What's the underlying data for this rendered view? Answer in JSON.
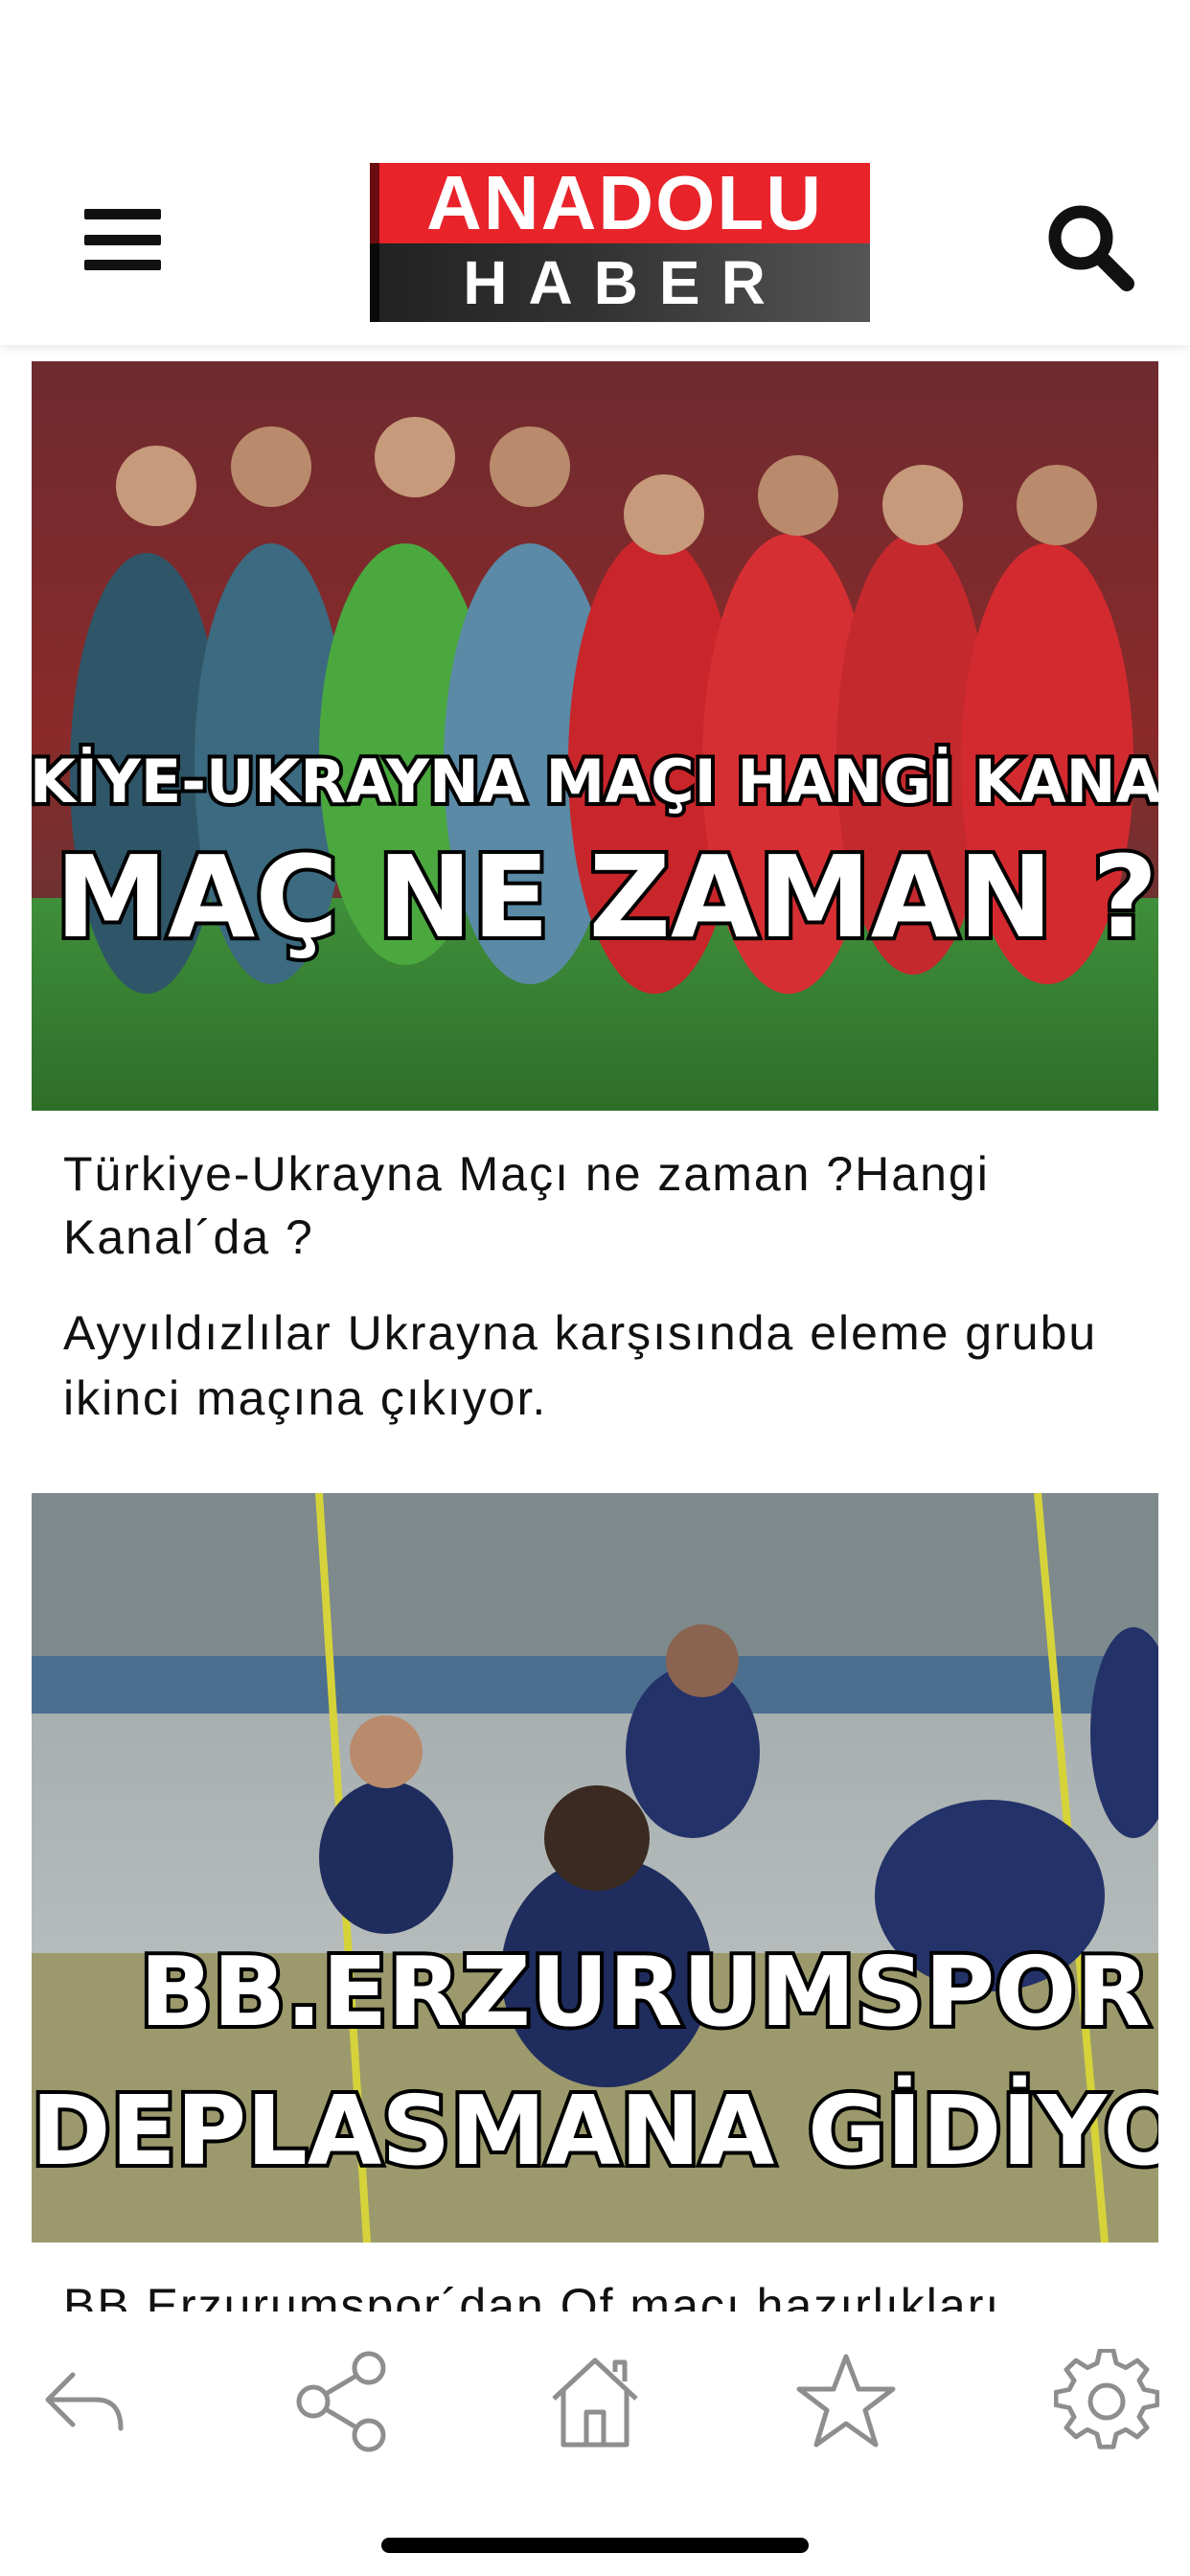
{
  "header": {
    "menu_icon": "hamburger-menu-icon",
    "search_icon": "search-icon",
    "logo": {
      "line1": "ANADOLU",
      "line2": "HABER"
    }
  },
  "articles": [
    {
      "image_caption_1": "TÜRKİYE-UKRAYNA MAÇI HANGİ KANALDA",
      "image_caption_2": "MAÇ NE ZAMAN ?",
      "title": "Türkiye-Ukrayna Maçı ne zaman ?Hangi Kanal´da ?",
      "description": "Ayyıldızlılar Ukrayna karşısında eleme grubu ikinci maçına çıkıyor."
    },
    {
      "image_caption_1": "BB.ERZURUMSPOR",
      "image_caption_2": "DEPLASMANA GİDİYOR",
      "title": "BB.Erzurumspor´dan Of maçı hazırlıkları"
    }
  ],
  "bottom_bar": {
    "items": [
      {
        "icon": "back-reply-icon"
      },
      {
        "icon": "share-icon"
      },
      {
        "icon": "home-icon"
      },
      {
        "icon": "star-icon"
      },
      {
        "icon": "settings-gear-icon"
      }
    ]
  },
  "colors": {
    "logo_red": "#e8232a",
    "logo_dark": "#222222",
    "icon_gray": "#8e8e8e"
  }
}
